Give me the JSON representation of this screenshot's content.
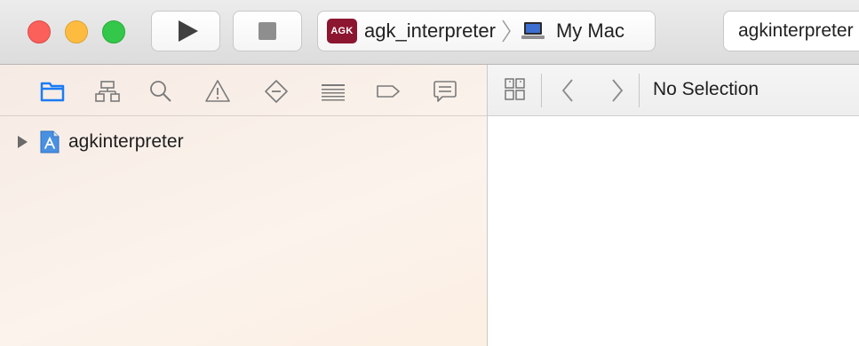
{
  "toolbar": {
    "window_controls": {
      "close": "close-button",
      "minimize": "minimize-button",
      "zoom": "zoom-button"
    },
    "run_icon": "play-icon",
    "stop_icon": "stop-icon",
    "scheme": {
      "badge_text": "AGK",
      "badge_color": "#8c1630",
      "name": "agk_interpreter",
      "separator_icon": "chevron-right-icon",
      "destination_icon": "laptop-icon",
      "destination": "My Mac"
    },
    "status": "agkinterpreter"
  },
  "navigator": {
    "tabs": [
      {
        "icon": "folder-icon",
        "selected": true
      },
      {
        "icon": "hierarchy-icon",
        "selected": false
      },
      {
        "icon": "search-icon",
        "selected": false
      },
      {
        "icon": "warning-icon",
        "selected": false
      },
      {
        "icon": "test-diamond-icon",
        "selected": false
      },
      {
        "icon": "debug-lines-icon",
        "selected": false
      },
      {
        "icon": "breakpoint-tag-icon",
        "selected": false
      },
      {
        "icon": "report-bubble-icon",
        "selected": false
      }
    ],
    "tree": [
      {
        "label": "agkinterpreter",
        "icon": "project-file-icon",
        "expanded": false
      }
    ]
  },
  "editor": {
    "jumpbar": {
      "related_icon": "related-items-icon",
      "back_icon": "chevron-left-icon",
      "forward_icon": "chevron-right-icon",
      "path_label": "No Selection"
    }
  },
  "colors": {
    "accent": "#1b7cf4",
    "icon_gray": "#7a7a7a",
    "close": "#fc605b",
    "minimize": "#fdbc40",
    "zoom": "#34c84a"
  }
}
